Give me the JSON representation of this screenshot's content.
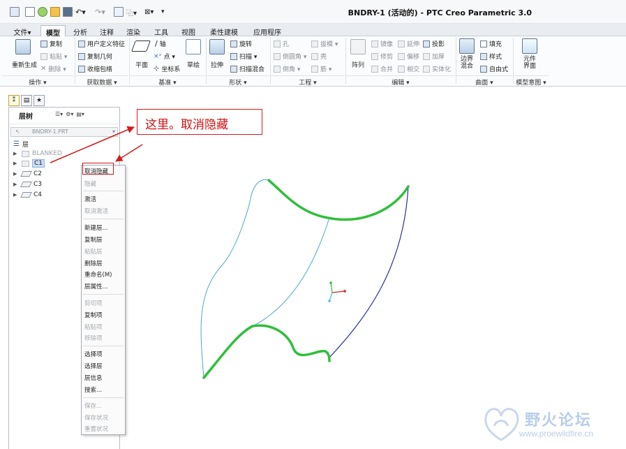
{
  "window": {
    "title": "BNDRY-1 (活动的) - PTC Creo Parametric 3.0"
  },
  "tabs": [
    "文件▾",
    "模型",
    "分析",
    "注释",
    "渲染",
    "工具",
    "视图",
    "柔性建模",
    "应用程序"
  ],
  "active_tab": "模型",
  "ribbon": {
    "ops": {
      "regen": "重新生成",
      "copy": "复制",
      "paste": "粘贴 ▾",
      "delete": "删除 ▾"
    },
    "getdata": {
      "udf": "用户定义特征",
      "copygeom": "复制几何",
      "shrinkwrap": "收缩包络"
    },
    "datum": {
      "plane": "平面",
      "axis": "轴",
      "point": "点 ▾",
      "csys": "坐标系",
      "sketch": "草绘"
    },
    "shapes": {
      "extrude": "拉伸",
      "revolve": "旋转",
      "sweep": "扫描 ▾",
      "sweptblend": "扫描混合"
    },
    "engineering": {
      "hole": "孔",
      "round": "倒圆角 ▾",
      "chamfer": "倒角 ▾",
      "draft": "拔模 ▾",
      "shell": "壳",
      "rib": "筋 ▾"
    },
    "edit": {
      "pattern": "阵列",
      "mirror": "镜像",
      "trim": "修剪",
      "merge": "合并",
      "extend": "延伸",
      "offset": "偏移",
      "intersect": "相交",
      "project": "投影",
      "thicken": "加厚",
      "solidify": "实体化"
    },
    "surfaces": {
      "boundary": "边界\n混合",
      "fill": "填充",
      "style": "样式",
      "freestyle": "自由式"
    },
    "intent": {
      "components": "元件\n界面"
    },
    "groups": {
      "operations": "操作 ▾",
      "getdata": "获取数据 ▾",
      "datum": "基准 ▾",
      "shapes": "形状 ▾",
      "engineering": "工程 ▾",
      "edit": "编辑 ▾",
      "surfaces": "曲面 ▾",
      "intent": "模型意图 ▾"
    }
  },
  "navigator": {
    "header": "层树",
    "model_select": "BNDRY-1.PRT",
    "root": "层",
    "layers": [
      "BLANKED",
      "C1",
      "C2",
      "C3",
      "C4"
    ],
    "selected_layer": "C1"
  },
  "context_menu": {
    "items": [
      {
        "label": "取消隐藏",
        "enabled": true
      },
      {
        "label": "隐藏",
        "enabled": false
      },
      {
        "label": "激活",
        "enabled": true
      },
      {
        "label": "取消激活",
        "enabled": false
      },
      {
        "label": "新建层...",
        "enabled": true
      },
      {
        "label": "复制层",
        "enabled": true
      },
      {
        "label": "粘贴层",
        "enabled": false
      },
      {
        "label": "删除层",
        "enabled": true
      },
      {
        "label": "重命名(M)",
        "enabled": true
      },
      {
        "label": "层属性...",
        "enabled": true
      },
      {
        "label": "剪切项",
        "enabled": false
      },
      {
        "label": "复制项",
        "enabled": true
      },
      {
        "label": "粘贴项",
        "enabled": false
      },
      {
        "label": "移除项",
        "enabled": false
      },
      {
        "label": "选择项",
        "enabled": true
      },
      {
        "label": "选择层",
        "enabled": true
      },
      {
        "label": "层信息",
        "enabled": true
      },
      {
        "label": "搜索...",
        "enabled": true
      },
      {
        "label": "保存...",
        "enabled": false
      },
      {
        "label": "保存状况",
        "enabled": false
      },
      {
        "label": "重置状况",
        "enabled": false
      }
    ]
  },
  "callout": {
    "text": "这里。取消隐藏"
  },
  "watermark": {
    "cn": "野火论坛",
    "url": "www.proewildfire.cn"
  },
  "colors": {
    "annotation_red": "#d41c1c",
    "curve_green": "#2fbf3a",
    "curve_cyan": "#4aa6cf",
    "curve_navy": "#23309a"
  }
}
